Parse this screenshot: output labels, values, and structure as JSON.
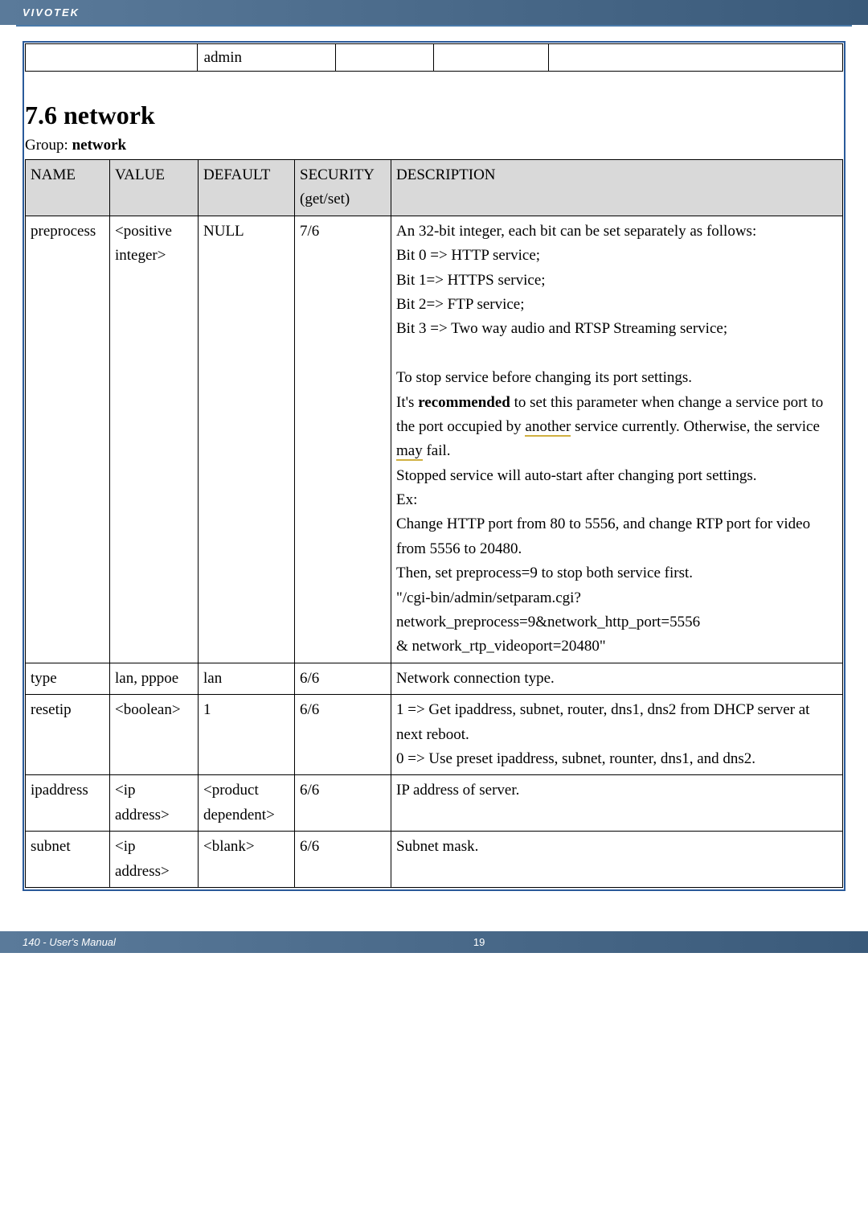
{
  "brand": "VIVOTEK",
  "top_strip": {
    "cell2": "admin"
  },
  "section": {
    "heading": "7.6 network",
    "group_prefix": "Group: ",
    "group_name": "network"
  },
  "table": {
    "head": {
      "name": "NAME",
      "value": "VALUE",
      "default": "DEFAULT",
      "security": "SECURITY (get/set)",
      "desc": "DESCRIPTION"
    },
    "rows": [
      {
        "name": "preprocess",
        "value": "<positive integer>",
        "default": "NULL",
        "security": "7/6",
        "desc_lines": [
          "An 32-bit integer, each bit can be set separately as follows:",
          "Bit 0 => HTTP service;",
          "Bit 1=> HTTPS service;",
          "Bit 2=> FTP service;",
          "Bit 3 => Two way audio and RTSP Streaming service;",
          "",
          "To stop service before changing its port settings.",
          "It's recommended to set this parameter when change a service port to the port occupied by another service currently. Otherwise, the service may fail.",
          "Stopped service will auto-start after changing port settings.",
          "Ex:",
          "Change HTTP port from 80 to 5556, and change RTP port for video from 5556 to 20480.",
          "Then, set preprocess=9 to stop both service first.",
          "\"/cgi-bin/admin/setparam.cgi?",
          "network_preprocess=9&network_http_port=5556",
          "& network_rtp_videoport=20480\""
        ]
      },
      {
        "name": "type",
        "value": "lan, pppoe",
        "default": "lan",
        "security": "6/6",
        "desc": "Network connection type."
      },
      {
        "name": "resetip",
        "value": "<boolean>",
        "default": "1",
        "security": "6/6",
        "desc": "1 => Get ipaddress, subnet, router, dns1, dns2 from DHCP server at next reboot.\n0 => Use preset ipaddress, subnet, rounter, dns1, and dns2."
      },
      {
        "name": "ipaddress",
        "value": "<ip address>",
        "default": "<product dependent>",
        "security": "6/6",
        "desc": "IP address of server."
      },
      {
        "name": "subnet",
        "value": "<ip address>",
        "default": "<blank>",
        "security": "6/6",
        "desc": "Subnet mask."
      }
    ]
  },
  "footer": {
    "left": "140 - User's Manual",
    "center": "19"
  }
}
